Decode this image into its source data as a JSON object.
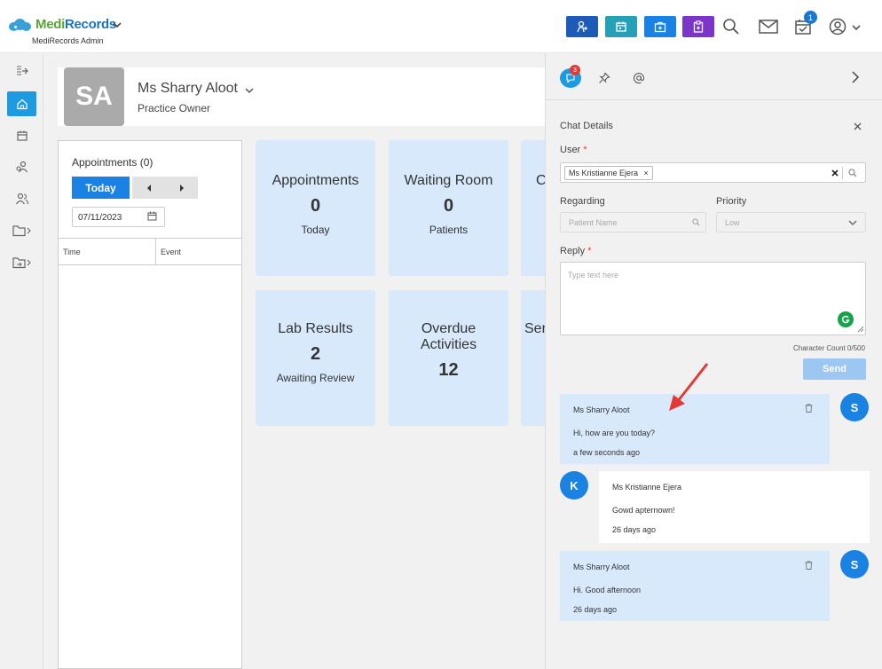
{
  "app": {
    "logo_medi": "Medi",
    "logo_records": "Records",
    "subtitle": "MediRecords Admin",
    "tasks_badge": "1"
  },
  "profile": {
    "initials": "SA",
    "name": "Ms Sharry Aloot",
    "role": "Practice Owner"
  },
  "appointments": {
    "title": "Appointments (0)",
    "today_label": "Today",
    "date": "07/11/2023",
    "columns": [
      "Time",
      "Event"
    ]
  },
  "tiles": [
    {
      "title": "Appointments",
      "value": "0",
      "sub": "Today"
    },
    {
      "title": "Waiting Room",
      "value": "0",
      "sub": "Patients"
    },
    {
      "title": "C",
      "value": "",
      "sub": ""
    },
    {
      "title": "Lab Results",
      "value": "2",
      "sub": "Awaiting Review"
    },
    {
      "title": "Overdue Activities",
      "value": "12",
      "sub": ""
    },
    {
      "title": "Ser",
      "value": "",
      "sub": ""
    }
  ],
  "chat": {
    "unread_badge": "3",
    "details_title": "Chat Details",
    "user_label": "User",
    "user_chip": "Ms Kristianne Ejera",
    "regarding_label": "Regarding",
    "regarding_placeholder": "Patient Name",
    "priority_label": "Priority",
    "priority_value": "Low",
    "reply_label": "Reply",
    "reply_placeholder": "Type text here",
    "char_count": "Character Count 0/500",
    "send_label": "Send",
    "messages": [
      {
        "initial": "S",
        "name": "Ms Sharry Aloot",
        "text": "Hi, how are you today?",
        "time": "a few seconds ago"
      },
      {
        "initial": "K",
        "name": "Ms Kristianne Ejera",
        "text": "Gowd apternown!",
        "time": "26 days ago"
      },
      {
        "initial": "S",
        "name": "Ms Sharry Aloot",
        "text": "Hi. Good afternoon",
        "time": "26 days ago"
      }
    ]
  },
  "colors": {
    "primary": "#1a82e2",
    "tile_bg": "#d8e9fc",
    "quick_btn_1": "#1c5cb8",
    "quick_btn_2": "#26a0b6",
    "quick_btn_3": "#1a82e2",
    "quick_btn_4": "#7b35c9"
  }
}
